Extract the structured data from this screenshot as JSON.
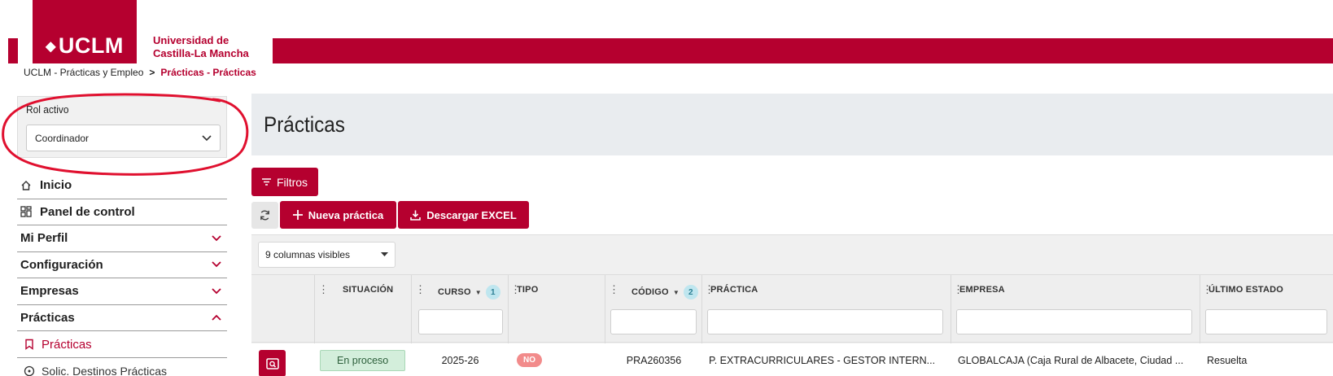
{
  "header": {
    "logo_text": "UCLM",
    "university_line1": "Universidad de",
    "university_line2": "Castilla-La Mancha"
  },
  "breadcrumb": {
    "root": "UCLM - Prácticas y Empleo",
    "separator": ">",
    "current": "Prácticas - Prácticas"
  },
  "role": {
    "label": "Rol activo",
    "selected": "Coordinador"
  },
  "nav": {
    "inicio": "Inicio",
    "panel": "Panel de control",
    "perfil": "Mi Perfil",
    "config": "Configuración",
    "empresas": "Empresas",
    "practicas": "Prácticas",
    "sub_practicas": "Prácticas",
    "sub_destinos": "Solic. Destinos Prácticas"
  },
  "main": {
    "title": "Prácticas",
    "filters_label": "Filtros",
    "new_label": "Nueva práctica",
    "excel_label": "Descargar EXCEL",
    "columns_select": "9 columnas visibles"
  },
  "table": {
    "headers": {
      "situacion": "SITUACIÓN",
      "curso": "CURSO",
      "curso_count": "1",
      "tipo": "TIPO",
      "codigo": "CÓDIGO",
      "codigo_count": "2",
      "practica": "PRÁCTICA",
      "empresa": "EMPRESA",
      "estado": "ÚLTIMO ESTADO"
    },
    "row": {
      "situacion": "En proceso",
      "curso": "2025-26",
      "tipo": "NO",
      "codigo": "PRA260356",
      "practica": "P. EXTRACURRICULARES - GESTOR INTERN...",
      "empresa": "GLOBALCAJA (Caja Rural de Albacete, Ciudad ...",
      "estado": "Resuelta"
    }
  },
  "colors": {
    "brand": "#b5002f",
    "annotation": "#e0102f"
  }
}
